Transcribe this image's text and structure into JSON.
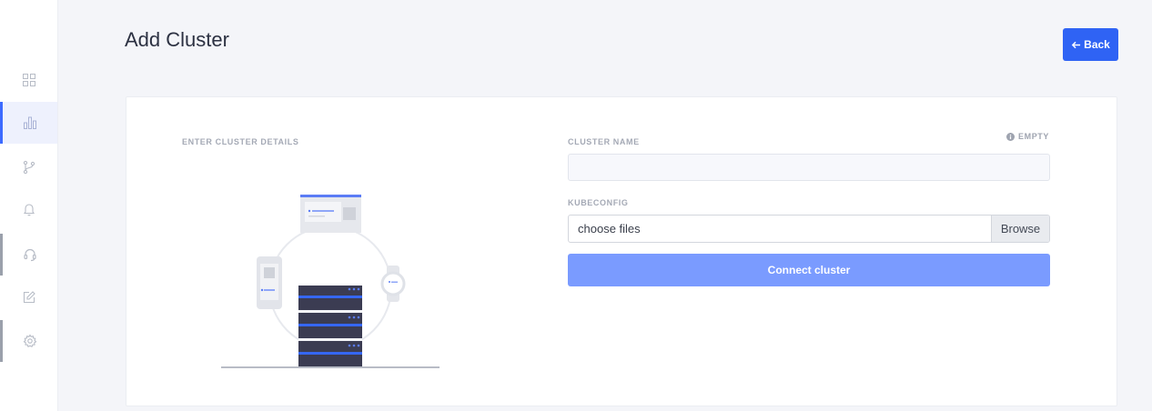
{
  "page": {
    "title": "Add Cluster",
    "back_label": "Back"
  },
  "form": {
    "section_heading": "ENTER CLUSTER DETAILS",
    "cluster_name_label": "CLUSTER NAME",
    "cluster_name_value": "",
    "status_badge": "EMPTY",
    "kubeconfig_label": "KUBECONFIG",
    "file_placeholder": "choose files",
    "browse_label": "Browse",
    "connect_label": "Connect cluster"
  },
  "sidebar": {
    "items": [
      {
        "icon": "dashboard-grid-icon",
        "active": false
      },
      {
        "icon": "cluster-chart-icon",
        "active": true
      },
      {
        "icon": "git-branch-icon",
        "active": false
      },
      {
        "icon": "bell-icon",
        "active": false
      },
      {
        "icon": "headset-icon",
        "active": false
      },
      {
        "icon": "edit-icon",
        "active": false
      },
      {
        "icon": "gear-icon",
        "active": false
      }
    ]
  },
  "colors": {
    "accent": "#2f63f4",
    "connect_button": "#7a9bff",
    "active_bar": "#3d6bff"
  }
}
